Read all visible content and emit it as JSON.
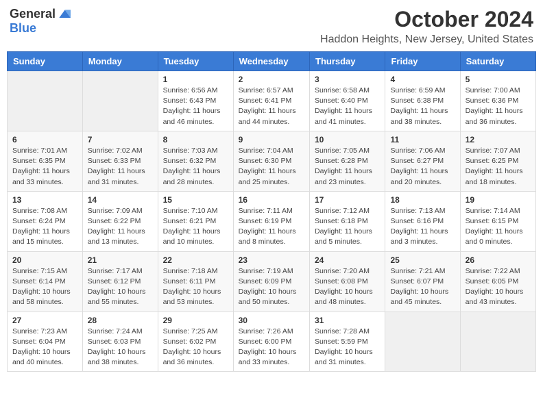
{
  "header": {
    "logo_general": "General",
    "logo_blue": "Blue",
    "month": "October 2024",
    "location": "Haddon Heights, New Jersey, United States"
  },
  "days_of_week": [
    "Sunday",
    "Monday",
    "Tuesday",
    "Wednesday",
    "Thursday",
    "Friday",
    "Saturday"
  ],
  "weeks": [
    [
      {
        "day": "",
        "info": ""
      },
      {
        "day": "",
        "info": ""
      },
      {
        "day": "1",
        "info": "Sunrise: 6:56 AM\nSunset: 6:43 PM\nDaylight: 11 hours and 46 minutes."
      },
      {
        "day": "2",
        "info": "Sunrise: 6:57 AM\nSunset: 6:41 PM\nDaylight: 11 hours and 44 minutes."
      },
      {
        "day": "3",
        "info": "Sunrise: 6:58 AM\nSunset: 6:40 PM\nDaylight: 11 hours and 41 minutes."
      },
      {
        "day": "4",
        "info": "Sunrise: 6:59 AM\nSunset: 6:38 PM\nDaylight: 11 hours and 38 minutes."
      },
      {
        "day": "5",
        "info": "Sunrise: 7:00 AM\nSunset: 6:36 PM\nDaylight: 11 hours and 36 minutes."
      }
    ],
    [
      {
        "day": "6",
        "info": "Sunrise: 7:01 AM\nSunset: 6:35 PM\nDaylight: 11 hours and 33 minutes."
      },
      {
        "day": "7",
        "info": "Sunrise: 7:02 AM\nSunset: 6:33 PM\nDaylight: 11 hours and 31 minutes."
      },
      {
        "day": "8",
        "info": "Sunrise: 7:03 AM\nSunset: 6:32 PM\nDaylight: 11 hours and 28 minutes."
      },
      {
        "day": "9",
        "info": "Sunrise: 7:04 AM\nSunset: 6:30 PM\nDaylight: 11 hours and 25 minutes."
      },
      {
        "day": "10",
        "info": "Sunrise: 7:05 AM\nSunset: 6:28 PM\nDaylight: 11 hours and 23 minutes."
      },
      {
        "day": "11",
        "info": "Sunrise: 7:06 AM\nSunset: 6:27 PM\nDaylight: 11 hours and 20 minutes."
      },
      {
        "day": "12",
        "info": "Sunrise: 7:07 AM\nSunset: 6:25 PM\nDaylight: 11 hours and 18 minutes."
      }
    ],
    [
      {
        "day": "13",
        "info": "Sunrise: 7:08 AM\nSunset: 6:24 PM\nDaylight: 11 hours and 15 minutes."
      },
      {
        "day": "14",
        "info": "Sunrise: 7:09 AM\nSunset: 6:22 PM\nDaylight: 11 hours and 13 minutes."
      },
      {
        "day": "15",
        "info": "Sunrise: 7:10 AM\nSunset: 6:21 PM\nDaylight: 11 hours and 10 minutes."
      },
      {
        "day": "16",
        "info": "Sunrise: 7:11 AM\nSunset: 6:19 PM\nDaylight: 11 hours and 8 minutes."
      },
      {
        "day": "17",
        "info": "Sunrise: 7:12 AM\nSunset: 6:18 PM\nDaylight: 11 hours and 5 minutes."
      },
      {
        "day": "18",
        "info": "Sunrise: 7:13 AM\nSunset: 6:16 PM\nDaylight: 11 hours and 3 minutes."
      },
      {
        "day": "19",
        "info": "Sunrise: 7:14 AM\nSunset: 6:15 PM\nDaylight: 11 hours and 0 minutes."
      }
    ],
    [
      {
        "day": "20",
        "info": "Sunrise: 7:15 AM\nSunset: 6:14 PM\nDaylight: 10 hours and 58 minutes."
      },
      {
        "day": "21",
        "info": "Sunrise: 7:17 AM\nSunset: 6:12 PM\nDaylight: 10 hours and 55 minutes."
      },
      {
        "day": "22",
        "info": "Sunrise: 7:18 AM\nSunset: 6:11 PM\nDaylight: 10 hours and 53 minutes."
      },
      {
        "day": "23",
        "info": "Sunrise: 7:19 AM\nSunset: 6:09 PM\nDaylight: 10 hours and 50 minutes."
      },
      {
        "day": "24",
        "info": "Sunrise: 7:20 AM\nSunset: 6:08 PM\nDaylight: 10 hours and 48 minutes."
      },
      {
        "day": "25",
        "info": "Sunrise: 7:21 AM\nSunset: 6:07 PM\nDaylight: 10 hours and 45 minutes."
      },
      {
        "day": "26",
        "info": "Sunrise: 7:22 AM\nSunset: 6:05 PM\nDaylight: 10 hours and 43 minutes."
      }
    ],
    [
      {
        "day": "27",
        "info": "Sunrise: 7:23 AM\nSunset: 6:04 PM\nDaylight: 10 hours and 40 minutes."
      },
      {
        "day": "28",
        "info": "Sunrise: 7:24 AM\nSunset: 6:03 PM\nDaylight: 10 hours and 38 minutes."
      },
      {
        "day": "29",
        "info": "Sunrise: 7:25 AM\nSunset: 6:02 PM\nDaylight: 10 hours and 36 minutes."
      },
      {
        "day": "30",
        "info": "Sunrise: 7:26 AM\nSunset: 6:00 PM\nDaylight: 10 hours and 33 minutes."
      },
      {
        "day": "31",
        "info": "Sunrise: 7:28 AM\nSunset: 5:59 PM\nDaylight: 10 hours and 31 minutes."
      },
      {
        "day": "",
        "info": ""
      },
      {
        "day": "",
        "info": ""
      }
    ]
  ]
}
